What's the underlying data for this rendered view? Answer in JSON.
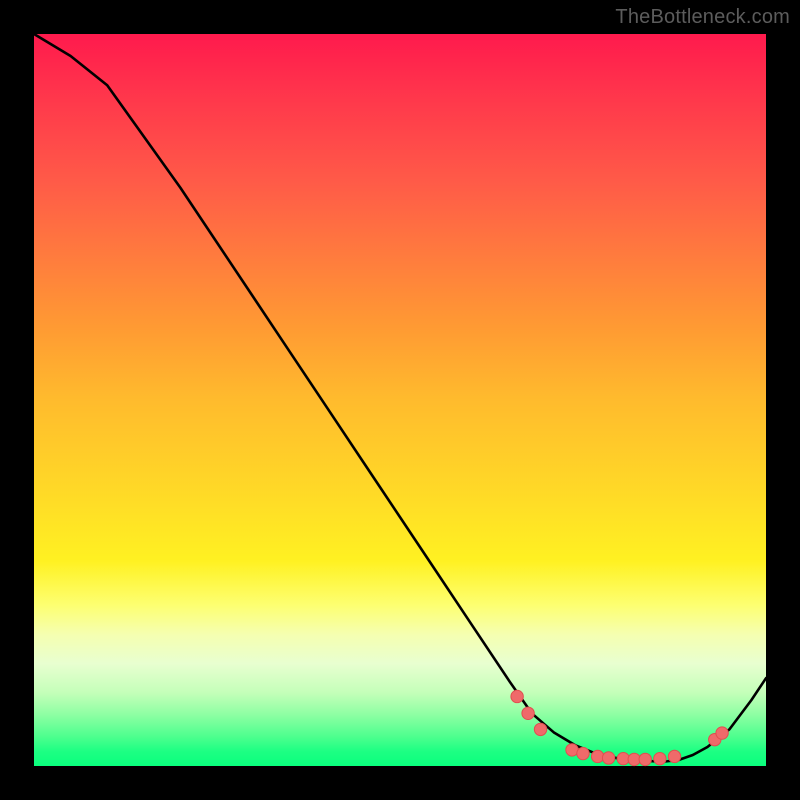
{
  "attribution": "TheBottleneck.com",
  "colors": {
    "curve_stroke": "#000000",
    "dot_fill": "#ef6a6a",
    "dot_stroke": "#e04f4f"
  },
  "chart_data": {
    "type": "line",
    "title": "",
    "xlabel": "",
    "ylabel": "",
    "xlim": [
      0,
      100
    ],
    "ylim": [
      0,
      100
    ],
    "grid": false,
    "legend": false,
    "series": [
      {
        "name": "curve",
        "x": [
          0,
          5,
          10,
          15,
          20,
          25,
          30,
          35,
          40,
          45,
          50,
          55,
          60,
          65,
          68,
          71,
          74,
          77,
          80,
          83,
          86,
          88,
          90,
          92,
          95,
          98,
          100
        ],
        "values": [
          100,
          97,
          93,
          86,
          79,
          71.5,
          64,
          56.5,
          49,
          41.5,
          34,
          26.5,
          19,
          11.5,
          7.2,
          4.6,
          2.8,
          1.6,
          1.0,
          0.7,
          0.6,
          0.8,
          1.5,
          2.6,
          5.0,
          9.0,
          12
        ]
      }
    ],
    "dots": [
      {
        "x": 66.0,
        "y": 9.5
      },
      {
        "x": 67.5,
        "y": 7.2
      },
      {
        "x": 69.2,
        "y": 5.0
      },
      {
        "x": 73.5,
        "y": 2.2
      },
      {
        "x": 75.0,
        "y": 1.7
      },
      {
        "x": 77.0,
        "y": 1.3
      },
      {
        "x": 78.5,
        "y": 1.1
      },
      {
        "x": 80.5,
        "y": 1.0
      },
      {
        "x": 82.0,
        "y": 0.9
      },
      {
        "x": 83.5,
        "y": 0.9
      },
      {
        "x": 85.5,
        "y": 1.0
      },
      {
        "x": 87.5,
        "y": 1.3
      },
      {
        "x": 93.0,
        "y": 3.6
      },
      {
        "x": 94.0,
        "y": 4.5
      }
    ]
  }
}
